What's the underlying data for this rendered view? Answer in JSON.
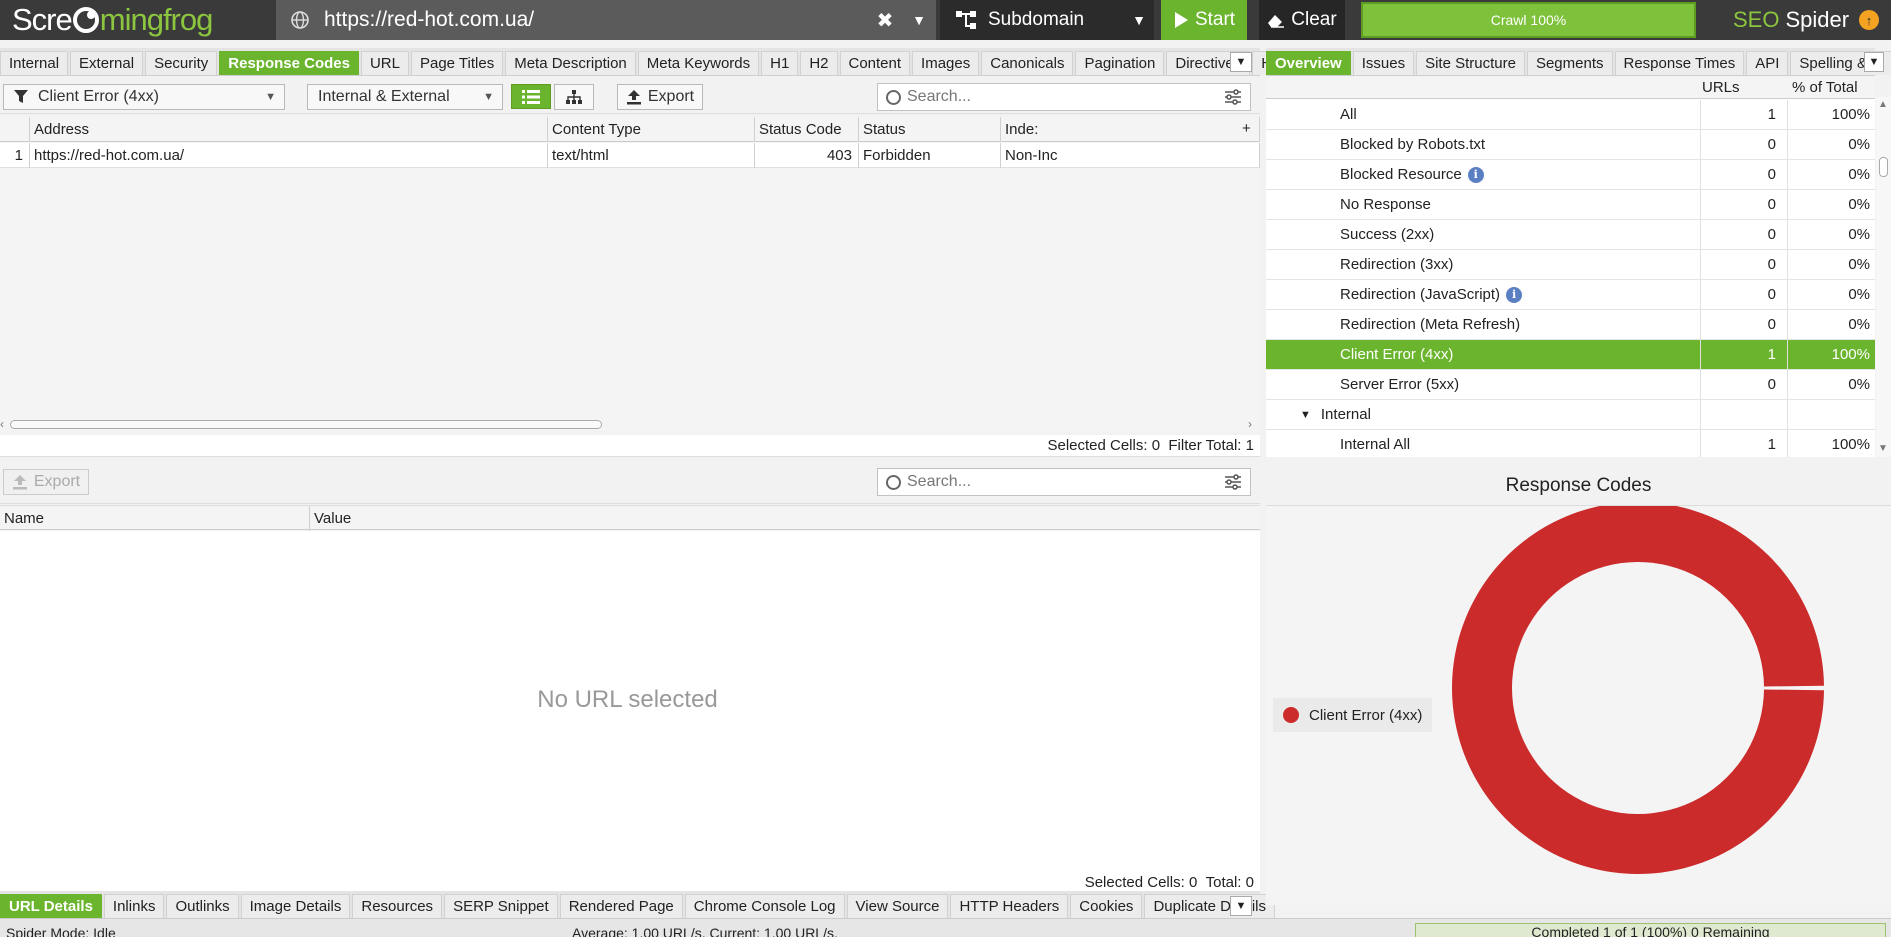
{
  "app": {
    "logo_left": "Scre",
    "logo_right": "mingfrog",
    "url": "https://red-hot.com.ua/",
    "mode": "Subdomain",
    "start_label": "Start",
    "clear_label": "Clear",
    "crawl_progress_label": "Crawl 100%",
    "crawl_progress": 1.0,
    "product_seo": "SEO",
    "product_spider": "Spider",
    "accent_color": "#6bb52e"
  },
  "main_tabs": [
    "Internal",
    "External",
    "Security",
    "Response Codes",
    "URL",
    "Page Titles",
    "Meta Description",
    "Meta Keywords",
    "H1",
    "H2",
    "Content",
    "Images",
    "Canonicals",
    "Pagination",
    "Directives",
    "Hr"
  ],
  "main_tabs_active": "Response Codes",
  "toolbar": {
    "filter_value": "Client Error (4xx)",
    "scope_value": "Internal & External",
    "export_label": "Export",
    "search_placeholder": "Search..."
  },
  "grid": {
    "headers": [
      "",
      "Address",
      "Content Type",
      "Status Code",
      "Status",
      "Inde:"
    ],
    "rows": [
      [
        "1",
        "https://red-hot.com.ua/",
        "text/html",
        "403",
        "Forbidden",
        "Non-Inc"
      ]
    ],
    "selected_cells_label": "Selected Cells:",
    "selected_cells": "0",
    "filter_total_label": "Filter Total:",
    "filter_total": "1"
  },
  "lower": {
    "export_label": "Export",
    "search_placeholder": "Search...",
    "headers": [
      "Name",
      "Value"
    ],
    "empty_text": "No URL selected",
    "selected_cells_label": "Selected Cells:",
    "selected_cells": "0",
    "total_label": "Total:",
    "total": "0"
  },
  "bottom_tabs": [
    "URL Details",
    "Inlinks",
    "Outlinks",
    "Image Details",
    "Resources",
    "SERP Snippet",
    "Rendered Page",
    "Chrome Console Log",
    "View Source",
    "HTTP Headers",
    "Cookies",
    "Duplicate Details"
  ],
  "bottom_tabs_active": "URL Details",
  "status": {
    "mode": "Spider Mode: Idle",
    "rate": "Average: 1.00 URL/s. Current: 1.00 URL/s.",
    "completed": "Completed 1 of 1 (100%) 0 Remaining"
  },
  "right_tabs": [
    "Overview",
    "Issues",
    "Site Structure",
    "Segments",
    "Response Times",
    "API",
    "Spelling & G"
  ],
  "right_tabs_active": "Overview",
  "overview": {
    "headers": [
      "URLs",
      "% of Total"
    ],
    "rows": [
      {
        "name": "All",
        "urls": "1",
        "pct": "100%",
        "info": false,
        "selected": false,
        "group": false
      },
      {
        "name": "Blocked by Robots.txt",
        "urls": "0",
        "pct": "0%",
        "info": false,
        "selected": false,
        "group": false
      },
      {
        "name": "Blocked Resource",
        "urls": "0",
        "pct": "0%",
        "info": true,
        "selected": false,
        "group": false
      },
      {
        "name": "No Response",
        "urls": "0",
        "pct": "0%",
        "info": false,
        "selected": false,
        "group": false
      },
      {
        "name": "Success (2xx)",
        "urls": "0",
        "pct": "0%",
        "info": false,
        "selected": false,
        "group": false
      },
      {
        "name": "Redirection (3xx)",
        "urls": "0",
        "pct": "0%",
        "info": false,
        "selected": false,
        "group": false
      },
      {
        "name": "Redirection (JavaScript)",
        "urls": "0",
        "pct": "0%",
        "info": true,
        "selected": false,
        "group": false
      },
      {
        "name": "Redirection (Meta Refresh)",
        "urls": "0",
        "pct": "0%",
        "info": false,
        "selected": false,
        "group": false
      },
      {
        "name": "Client Error (4xx)",
        "urls": "1",
        "pct": "100%",
        "info": false,
        "selected": true,
        "group": false
      },
      {
        "name": "Server Error (5xx)",
        "urls": "0",
        "pct": "0%",
        "info": false,
        "selected": false,
        "group": false
      },
      {
        "name": "Internal",
        "urls": "",
        "pct": "",
        "info": false,
        "selected": false,
        "group": true
      },
      {
        "name": "Internal All",
        "urls": "1",
        "pct": "100%",
        "info": false,
        "selected": false,
        "group": false
      }
    ]
  },
  "chart_data": {
    "type": "pie",
    "title": "Response Codes",
    "donut": true,
    "categories": [
      "Client Error (4xx)"
    ],
    "values": [
      1
    ],
    "colors": [
      "#cc2b2b"
    ],
    "legend_placement": "left"
  }
}
